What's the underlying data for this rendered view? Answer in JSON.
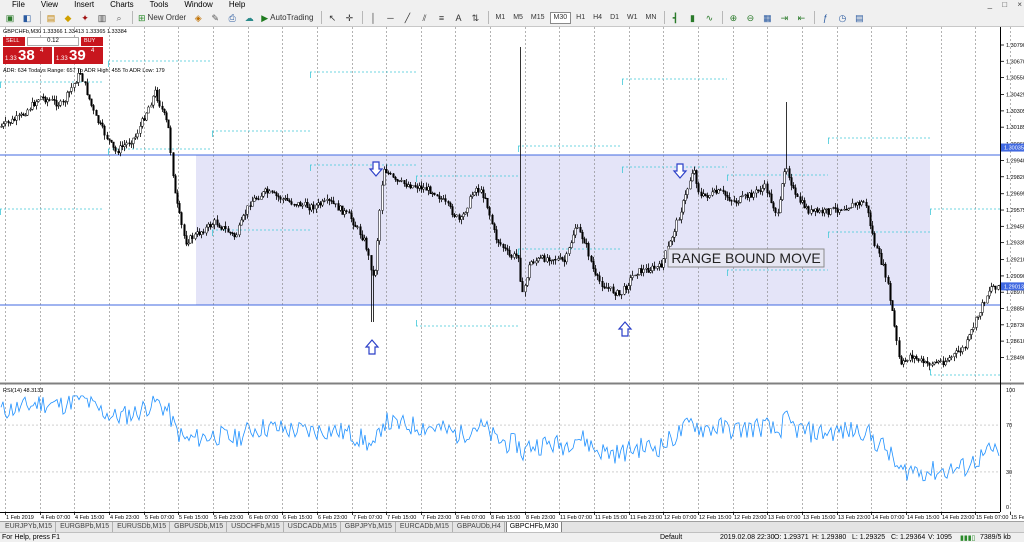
{
  "menu": [
    "File",
    "View",
    "Insert",
    "Charts",
    "Tools",
    "Window",
    "Help"
  ],
  "window_controls": [
    "_",
    "□",
    "×"
  ],
  "toolbar": {
    "new_order": "New Order",
    "autotrading": "AutoTrading",
    "timeframes": [
      "M1",
      "M5",
      "M15",
      "M30",
      "H1",
      "H4",
      "D1",
      "W1",
      "MN"
    ],
    "active_timeframe": "M30"
  },
  "chart": {
    "symbol_info": "GBPCHFb,M30  1.33366 1.33413 1.33365 1.33384",
    "adr_info": "ADR: 634  Todays Range: 657  To ADR High: 455  To ADR Low: 179",
    "rsi_label": "RSI(14) 48.3133",
    "range_label": "RANGE BOUND MOVE",
    "trade_panel": {
      "sell_label": "SELL",
      "buy_label": "BUY",
      "lot": "0.12",
      "sell_prefix": "1.33",
      "sell_big": "38",
      "sell_sup": "4",
      "buy_prefix": "1.33",
      "buy_big": "39",
      "buy_sup": "4"
    },
    "price_axis": [
      "1.30790",
      "1.30670",
      "1.30550",
      "1.30425",
      "1.30305",
      "1.30185",
      "1.30060",
      "1.29940",
      "1.29820",
      "1.29695",
      "1.29575",
      "1.29455",
      "1.29335",
      "1.29210",
      "1.29090",
      "1.28970",
      "1.28850",
      "1.28730",
      "1.28610",
      "1.28490"
    ],
    "price_highlights": [
      "1.30035",
      "1.29013"
    ],
    "rsi_axis": [
      "100",
      "70",
      "30",
      "0"
    ],
    "time_axis": [
      "1 Feb 2019",
      "4 Feb 07:00",
      "4 Feb 15:00",
      "4 Feb 23:00",
      "5 Feb 07:00",
      "5 Feb 15:00",
      "5 Feb 23:00",
      "6 Feb 07:00",
      "6 Feb 15:00",
      "6 Feb 23:00",
      "7 Feb 07:00",
      "7 Feb 15:00",
      "7 Feb 23:00",
      "8 Feb 07:00",
      "8 Feb 15:00",
      "8 Feb 23:00",
      "11 Feb 07:00",
      "11 Feb 15:00",
      "11 Feb 23:00",
      "12 Feb 07:00",
      "12 Feb 15:00",
      "12 Feb 23:00",
      "13 Feb 07:00",
      "13 Feb 15:00",
      "13 Feb 23:00",
      "14 Feb 07:00",
      "14 Feb 15:00",
      "14 Feb 23:00",
      "15 Feb 07:00",
      "15 Feb 15:00"
    ],
    "colors": {
      "range_fill": "#e4e4f8",
      "support_line": "#4169e1",
      "rsi_line": "#1e90ff",
      "sell_red": "#c8161e",
      "arrow_blue": "#2b3fc8"
    }
  },
  "tabs": [
    "EURJPYb,M15",
    "EURGBPb,M15",
    "EURUSDb,M15",
    "GBPUSDb,M15",
    "USDCHFb,M15",
    "USDCADb,M15",
    "GBPJPYb,M15",
    "EURCADb,M15",
    "GBPAUDb,H4",
    "GBPCHFb,M30"
  ],
  "active_tab": "GBPCHFb,M30",
  "status": {
    "help": "For Help, press F1",
    "profile": "Default",
    "datetime": "2019.02.08 22:30",
    "open": "O: 1.29371",
    "high": "H: 1.29380",
    "low": "L: 1.29325",
    "close": "C: 1.29364",
    "volume": "V: 1095",
    "traffic": "7389/5 kb"
  }
}
